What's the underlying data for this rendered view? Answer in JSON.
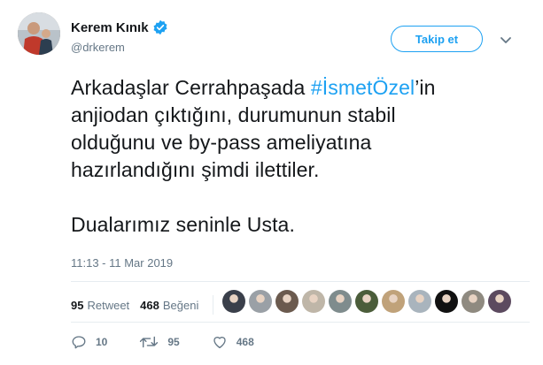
{
  "author": {
    "display_name": "Kerem Kınık",
    "handle": "@drkerem"
  },
  "follow_button_label": "Takip et",
  "tweet": {
    "line1_before": "Arkadaşlar Cerrahpaşada ",
    "hashtag": "#İsmetÖzel",
    "line1_after": "’in",
    "line2": "anjiodan çıktığını, durumunun stabil",
    "line3": "olduğunu ve by-pass ameliyatına",
    "line4": "hazırlandığını şimdi ilettiler.",
    "line5": "Dualarımız seninle Usta."
  },
  "timestamp": "11:13 - 11 Mar 2019",
  "stats": {
    "retweet_count": "95",
    "retweet_label": "Retweet",
    "like_count": "468",
    "like_label": "Beğeni"
  },
  "liker_avatar_colors": [
    "#3a3f4a",
    "#9aa0a6",
    "#6b5a4e",
    "#bfb6a8",
    "#7f8c8d",
    "#4b5d3a",
    "#c0a27a",
    "#a9b4bd",
    "#111111",
    "#8f8a80",
    "#5c4a5f"
  ],
  "actions": {
    "reply_count": "10",
    "retweet_count": "95",
    "like_count": "468"
  },
  "colors": {
    "accent": "#1da1f2",
    "muted": "#657786",
    "text": "#14171a"
  }
}
